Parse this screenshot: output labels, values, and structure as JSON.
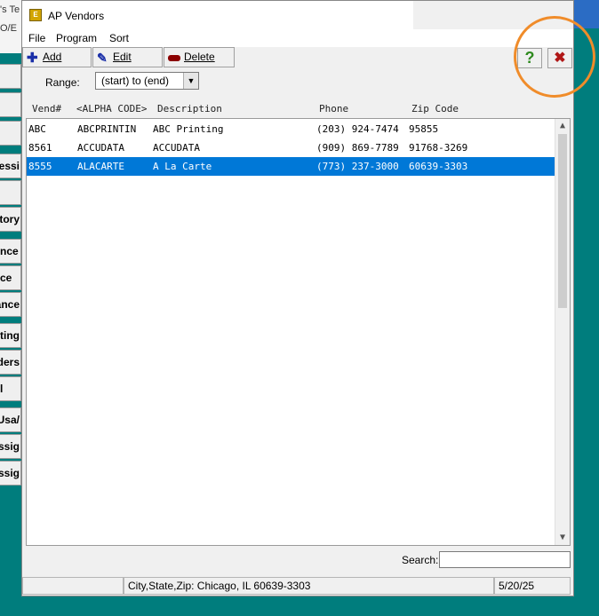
{
  "background_app": {
    "top_lines": [
      "'s Te",
      "O/E"
    ],
    "side_buttons": [
      "",
      "",
      "",
      "essi",
      "",
      "tory",
      "nce",
      "ce",
      "ance",
      "ting",
      "ders",
      "l",
      "/Usa",
      "ssig",
      "ssig"
    ]
  },
  "window": {
    "title": "AP Vendors",
    "menu": [
      "File",
      "Program",
      "Sort"
    ]
  },
  "toolbar": {
    "add_label": "Add",
    "edit_label": "Edit",
    "delete_label": "Delete",
    "help_glyph": "?",
    "close_glyph": "✖"
  },
  "range": {
    "label": "Range:",
    "value": "(start) to (end)"
  },
  "columns": {
    "vend": "Vend#",
    "alpha": "<ALPHA CODE>",
    "desc": "Description",
    "phone": "Phone",
    "zip": "Zip Code"
  },
  "vendors": [
    {
      "vend": "ABC",
      "alpha": "ABCPRINTIN",
      "desc": "ABC Printing",
      "phone": "(203) 924-7474",
      "zip": "95855",
      "selected": false
    },
    {
      "vend": "8561",
      "alpha": "ACCUDATA",
      "desc": "ACCUDATA",
      "phone": "(909) 869-7789",
      "zip": "91768-3269",
      "selected": false
    },
    {
      "vend": "8555",
      "alpha": "ALACARTE",
      "desc": "A La Carte",
      "phone": "(773) 237-3000",
      "zip": "60639-3303",
      "selected": true
    }
  ],
  "search": {
    "label": "Search:",
    "value": ""
  },
  "status": {
    "info": "City,State,Zip: Chicago, IL  60639-3303",
    "date": "5/20/25"
  },
  "colors": {
    "selection": "#0078d7",
    "desktop": "#007d7d",
    "highlight": "#f08c2a"
  }
}
